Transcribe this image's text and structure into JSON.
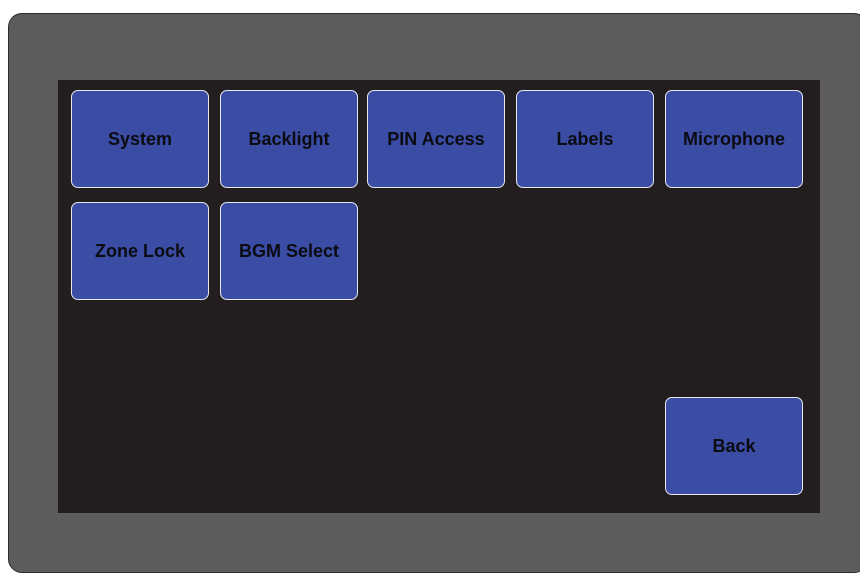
{
  "menu": {
    "buttons": [
      {
        "id": "system",
        "label": "System"
      },
      {
        "id": "backlight",
        "label": "Backlight"
      },
      {
        "id": "pin-access",
        "label": "PIN Access"
      },
      {
        "id": "labels",
        "label": "Labels"
      },
      {
        "id": "microphone",
        "label": "Microphone"
      },
      {
        "id": "zone-lock",
        "label": "Zone Lock"
      },
      {
        "id": "bgm-select",
        "label": "BGM Select"
      }
    ],
    "back_label": "Back"
  },
  "colors": {
    "bezel": "#5c5c5d",
    "screen": "#221e1f",
    "button": "#3b4ca4",
    "button_border": "#e8e8ee",
    "button_text": "#0b0b12"
  }
}
